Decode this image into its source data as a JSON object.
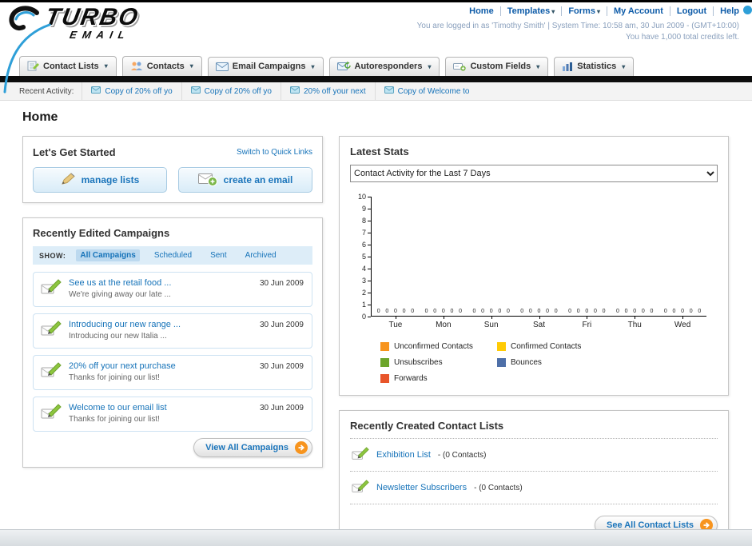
{
  "page_title": "Home",
  "icons": {
    "dropdown_arrow": "▾"
  },
  "header": {
    "logo": {
      "line1": "TURBO",
      "line2": "EMAIL"
    },
    "nav_links": [
      "Home",
      "Templates",
      "Forms",
      "My Account",
      "Logout",
      "Help"
    ],
    "login_info": "You are logged in as 'Timothy Smith' | System Time: 10:58 am, 30 Jun 2009 - (GMT+10:00)",
    "credits_info": "You have 1,000 total credits left."
  },
  "nav": {
    "tabs": [
      {
        "label": "Contact Lists"
      },
      {
        "label": "Contacts"
      },
      {
        "label": "Email Campaigns"
      },
      {
        "label": "Autoresponders"
      },
      {
        "label": "Custom Fields"
      },
      {
        "label": "Statistics"
      }
    ]
  },
  "recent_activity": {
    "label": "Recent Activity:",
    "items": [
      "Copy of 20% off yo",
      "Copy of 20% off yo",
      "20% off your next",
      "Copy of Welcome to"
    ]
  },
  "get_started": {
    "title": "Let's Get Started",
    "switch_link": "Switch to Quick Links",
    "manage_lists_label": "manage lists",
    "create_email_label": "create an email"
  },
  "campaigns": {
    "title": "Recently Edited Campaigns",
    "show_label": "SHOW:",
    "tabs": [
      "All Campaigns",
      "Scheduled",
      "Sent",
      "Archived"
    ],
    "active_tab": "All Campaigns",
    "items": [
      {
        "title": "See us at the retail food ...",
        "subtitle": "We're giving away our late ...",
        "date": "30 Jun 2009"
      },
      {
        "title": "Introducing our new range ...",
        "subtitle": "Introducing our new Italia ...",
        "date": "30 Jun 2009"
      },
      {
        "title": "20% off your next purchase",
        "subtitle": "Thanks for joining our list!",
        "date": "30 Jun 2009"
      },
      {
        "title": "Welcome to our email list",
        "subtitle": "Thanks for joining our list!",
        "date": "30 Jun 2009"
      }
    ],
    "view_all_label": "View All Campaigns"
  },
  "stats": {
    "title": "Latest Stats",
    "dropdown_value": "Contact Activity for the Last 7 Days"
  },
  "chart_data": {
    "type": "bar",
    "title": "Contact Activity for the Last 7 Days",
    "categories": [
      "Tue",
      "Mon",
      "Sun",
      "Sat",
      "Fri",
      "Thu",
      "Wed"
    ],
    "series": [
      {
        "name": "Unconfirmed Contacts",
        "color": "#F7941E",
        "values": [
          0,
          0,
          0,
          0,
          0,
          0,
          0
        ]
      },
      {
        "name": "Confirmed Contacts",
        "color": "#FFCB05",
        "values": [
          0,
          0,
          0,
          0,
          0,
          0,
          0
        ]
      },
      {
        "name": "Unsubscribes",
        "color": "#6CA52B",
        "values": [
          0,
          0,
          0,
          0,
          0,
          0,
          0
        ]
      },
      {
        "name": "Bounces",
        "color": "#4E6FA8",
        "values": [
          0,
          0,
          0,
          0,
          0,
          0,
          0
        ]
      },
      {
        "name": "Forwards",
        "color": "#E8552A",
        "values": [
          0,
          0,
          0,
          0,
          0,
          0,
          0
        ]
      }
    ],
    "ylim": [
      0,
      10
    ],
    "ytick_step": 1,
    "grid": false,
    "legend_position": "bottom"
  },
  "contact_lists": {
    "title": "Recently Created Contact Lists",
    "items": [
      {
        "name": "Exhibition List",
        "detail": "- (0 Contacts)"
      },
      {
        "name": "Newsletter Subscribers",
        "detail": "- (0 Contacts)"
      }
    ],
    "see_all_label": "See All Contact Lists"
  }
}
